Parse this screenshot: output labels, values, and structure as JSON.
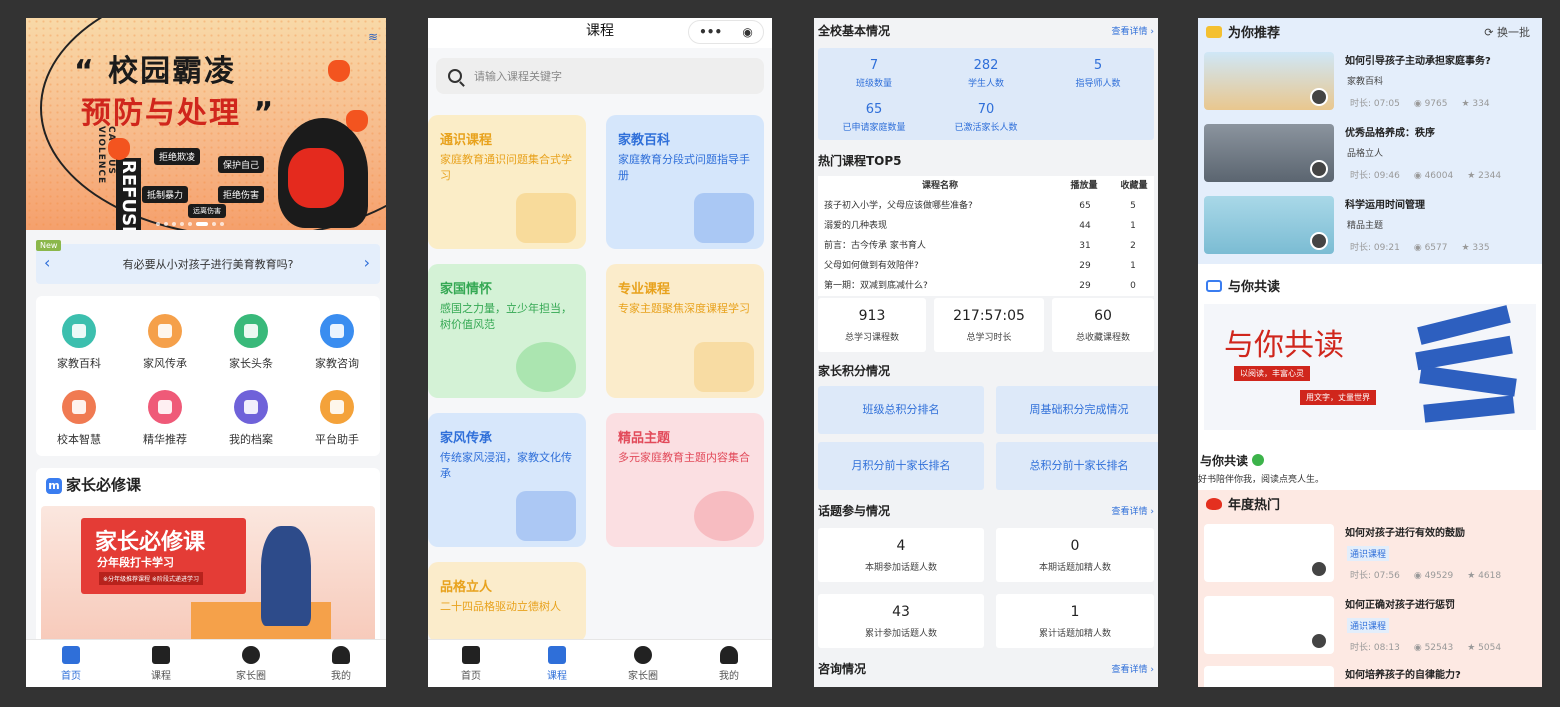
{
  "screen1": {
    "banner": {
      "title1": "“ 校园霸凌",
      "title2": "预防与处理",
      "title2_end": "”",
      "vertical": "CAMPUS VIOLENCE",
      "refuse": "REFUSE",
      "tags": [
        "拒绝欺凌",
        "保护自己",
        "抵制暴力",
        "拒绝伤害",
        "远离伤害"
      ]
    },
    "notice": {
      "badge": "New",
      "text": "有必要从小对孩子进行美育教育吗?",
      "prev": "‹",
      "next": "›"
    },
    "grid": [
      {
        "label": "家教百科",
        "icon": "book-icon",
        "color": "#3cbfae"
      },
      {
        "label": "家风传承",
        "icon": "house-icon",
        "color": "#f5a04a"
      },
      {
        "label": "家长头条",
        "icon": "news-icon",
        "color": "#39b97a"
      },
      {
        "label": "家教咨询",
        "icon": "chat-icon",
        "color": "#3a8df0"
      },
      {
        "label": "校本智慧",
        "icon": "bulb-icon",
        "color": "#f07a52"
      },
      {
        "label": "精华推荐",
        "icon": "star-icon",
        "color": "#ef5a78"
      },
      {
        "label": "我的档案",
        "icon": "folder-icon",
        "color": "#6f62d9"
      },
      {
        "label": "平台助手",
        "icon": "assistant-icon",
        "color": "#f4a23a"
      }
    ],
    "must": {
      "icon": "m",
      "title": "家长必修课",
      "board_title": "家长必修课",
      "board_sub": "分年段打卡学习",
      "board_tags": "※分年级推荐课程 ※阶段式递进学习"
    },
    "tabs": [
      "首页",
      "课程",
      "家长圈",
      "我的"
    ]
  },
  "screen2": {
    "title": "课程",
    "capsule": [
      "•••",
      "◉"
    ],
    "search_placeholder": "请输入课程关键字",
    "cards": [
      {
        "title": "通识课程",
        "desc": "家庭教育通识问题集合式学习",
        "bg": "#fbedc7",
        "fg": "#e8a21d"
      },
      {
        "title": "家教百科",
        "desc": "家庭教育分段式问题指导手册",
        "bg": "#d5e6fb",
        "fg": "#2f6fd9"
      },
      {
        "title": "家国情怀",
        "desc": "感国之力量，立少年担当，树价值风范",
        "bg": "#d4f2d6",
        "fg": "#34a853"
      },
      {
        "title": "专业课程",
        "desc": "专家主题聚焦深度课程学习",
        "bg": "#fbeccb",
        "fg": "#e8a21d"
      },
      {
        "title": "家风传承",
        "desc": "传统家风浸润，家教文化传承",
        "bg": "#d7e7fb",
        "fg": "#2f6fd9"
      },
      {
        "title": "精品主题",
        "desc": "多元家庭教育主题内容集合",
        "bg": "#fbdfe2",
        "fg": "#e24a5a"
      },
      {
        "title": "品格立人",
        "desc": "二十四品格驱动立德树人",
        "bg": "#fbeccb",
        "fg": "#e8a21d"
      }
    ],
    "tabs": [
      "首页",
      "课程",
      "家长圈",
      "我的"
    ]
  },
  "screen3": {
    "basic": {
      "title": "全校基本情况",
      "more": "查看详情 ›",
      "stats": [
        {
          "value": "7",
          "label": "班级数量"
        },
        {
          "value": "282",
          "label": "学生人数"
        },
        {
          "value": "5",
          "label": "指导师人数"
        },
        {
          "value": "65",
          "label": "已申请家庭数量"
        },
        {
          "value": "70",
          "label": "已激活家长人数"
        }
      ]
    },
    "top5": {
      "title": "热门课程TOP5",
      "headers": [
        "课程名称",
        "播放量",
        "收藏量"
      ],
      "rows": [
        {
          "name": "孩子初入小学，父母应该做哪些准备?",
          "plays": "65",
          "favs": "5"
        },
        {
          "name": "溺爱的几种表现",
          "plays": "44",
          "favs": "1"
        },
        {
          "name": "前言：古今传承 家书育人",
          "plays": "31",
          "favs": "2"
        },
        {
          "name": "父母如何做到有效陪伴?",
          "plays": "29",
          "favs": "1"
        },
        {
          "name": "第一期：双减到底减什么?",
          "plays": "29",
          "favs": "0"
        }
      ]
    },
    "totals": [
      {
        "value": "913",
        "label": "总学习课程数"
      },
      {
        "value": "217:57:05",
        "label": "总学习时长"
      },
      {
        "value": "60",
        "label": "总收藏课程数"
      }
    ],
    "points": {
      "title": "家长积分情况",
      "buttons": [
        "班级总积分排名",
        "周基础积分完成情况",
        "月积分前十家长排名",
        "总积分前十家长排名"
      ]
    },
    "topics": {
      "title": "话题参与情况",
      "more": "查看详情 ›",
      "stats": [
        {
          "value": "4",
          "label": "本期参加话题人数"
        },
        {
          "value": "0",
          "label": "本期话题加精人数"
        },
        {
          "value": "43",
          "label": "累计参加话题人数"
        },
        {
          "value": "1",
          "label": "累计话题加精人数"
        }
      ]
    },
    "consult": {
      "title": "咨询情况",
      "more": "查看详情 ›"
    }
  },
  "screen4": {
    "recommend": {
      "title": "为你推荐",
      "refresh": "⟳ 换一批",
      "items": [
        {
          "title": "如何引导孩子主动承担家庭事务?",
          "category": "家教百科",
          "duration": "时长: 07:05",
          "views": "9765",
          "likes": "334"
        },
        {
          "title": "优秀品格养成：秩序",
          "category": "品格立人",
          "duration": "时长: 09:46",
          "views": "46004",
          "likes": "2344"
        },
        {
          "title": "科学运用时间管理",
          "category": "精品主题",
          "duration": "时长: 09:21",
          "views": "6577",
          "likes": "335"
        }
      ]
    },
    "read": {
      "title": "与你共读",
      "banner_title": "与你共读",
      "banner_tag1": "以阅读，丰富心灵",
      "banner_tag2": "用文字，丈量世界",
      "name": "与你共读",
      "desc": "好书陪伴你我，阅读点亮人生。"
    },
    "yearly": {
      "title": "年度热门",
      "items": [
        {
          "title": "如何对孩子进行有效的鼓励",
          "category": "通识课程",
          "duration": "时长: 07:56",
          "views": "49529",
          "likes": "4618"
        },
        {
          "title": "如何正确对孩子进行惩罚",
          "category": "通识课程",
          "duration": "时长: 08:13",
          "views": "52543",
          "likes": "5054"
        },
        {
          "title": "如何培养孩子的自律能力?",
          "category": "",
          "duration": "",
          "views": "",
          "likes": ""
        }
      ]
    }
  }
}
